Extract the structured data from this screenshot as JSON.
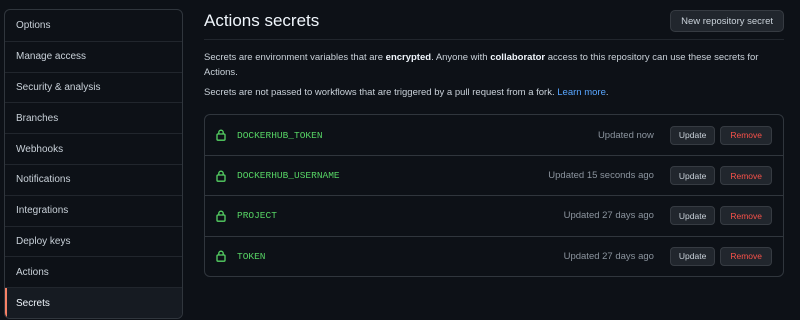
{
  "sidebar": {
    "items": [
      {
        "label": "Options"
      },
      {
        "label": "Manage access"
      },
      {
        "label": "Security & analysis"
      },
      {
        "label": "Branches"
      },
      {
        "label": "Webhooks"
      },
      {
        "label": "Notifications"
      },
      {
        "label": "Integrations"
      },
      {
        "label": "Deploy keys"
      },
      {
        "label": "Actions"
      },
      {
        "label": "Secrets",
        "active": true
      }
    ]
  },
  "header": {
    "title": "Actions secrets",
    "new_button": "New repository secret"
  },
  "description": {
    "p1_a": "Secrets are environment variables that are ",
    "p1_b": "encrypted",
    "p1_c": ". Anyone with ",
    "p1_d": "collaborator",
    "p1_e": " access to this repository can use these secrets for Actions.",
    "p2_a": "Secrets are not passed to workflows that are triggered by a pull request from a fork. ",
    "p2_link": "Learn more",
    "p2_b": "."
  },
  "secrets": [
    {
      "name": "DOCKERHUB_TOKEN",
      "updated": "Updated now",
      "update_label": "Update",
      "remove_label": "Remove"
    },
    {
      "name": "DOCKERHUB_USERNAME",
      "updated": "Updated 15 seconds ago",
      "update_label": "Update",
      "remove_label": "Remove"
    },
    {
      "name": "PROJECT",
      "updated": "Updated 27 days ago",
      "update_label": "Update",
      "remove_label": "Remove"
    },
    {
      "name": "TOKEN",
      "updated": "Updated 27 days ago",
      "update_label": "Update",
      "remove_label": "Remove"
    }
  ],
  "icons": {
    "secret_icon": "lock-icon"
  },
  "colors": {
    "background": "#0d1117",
    "secret_name": "#56d364",
    "link": "#58a6ff",
    "remove": "#f85149",
    "active_indicator": "#f78166"
  }
}
